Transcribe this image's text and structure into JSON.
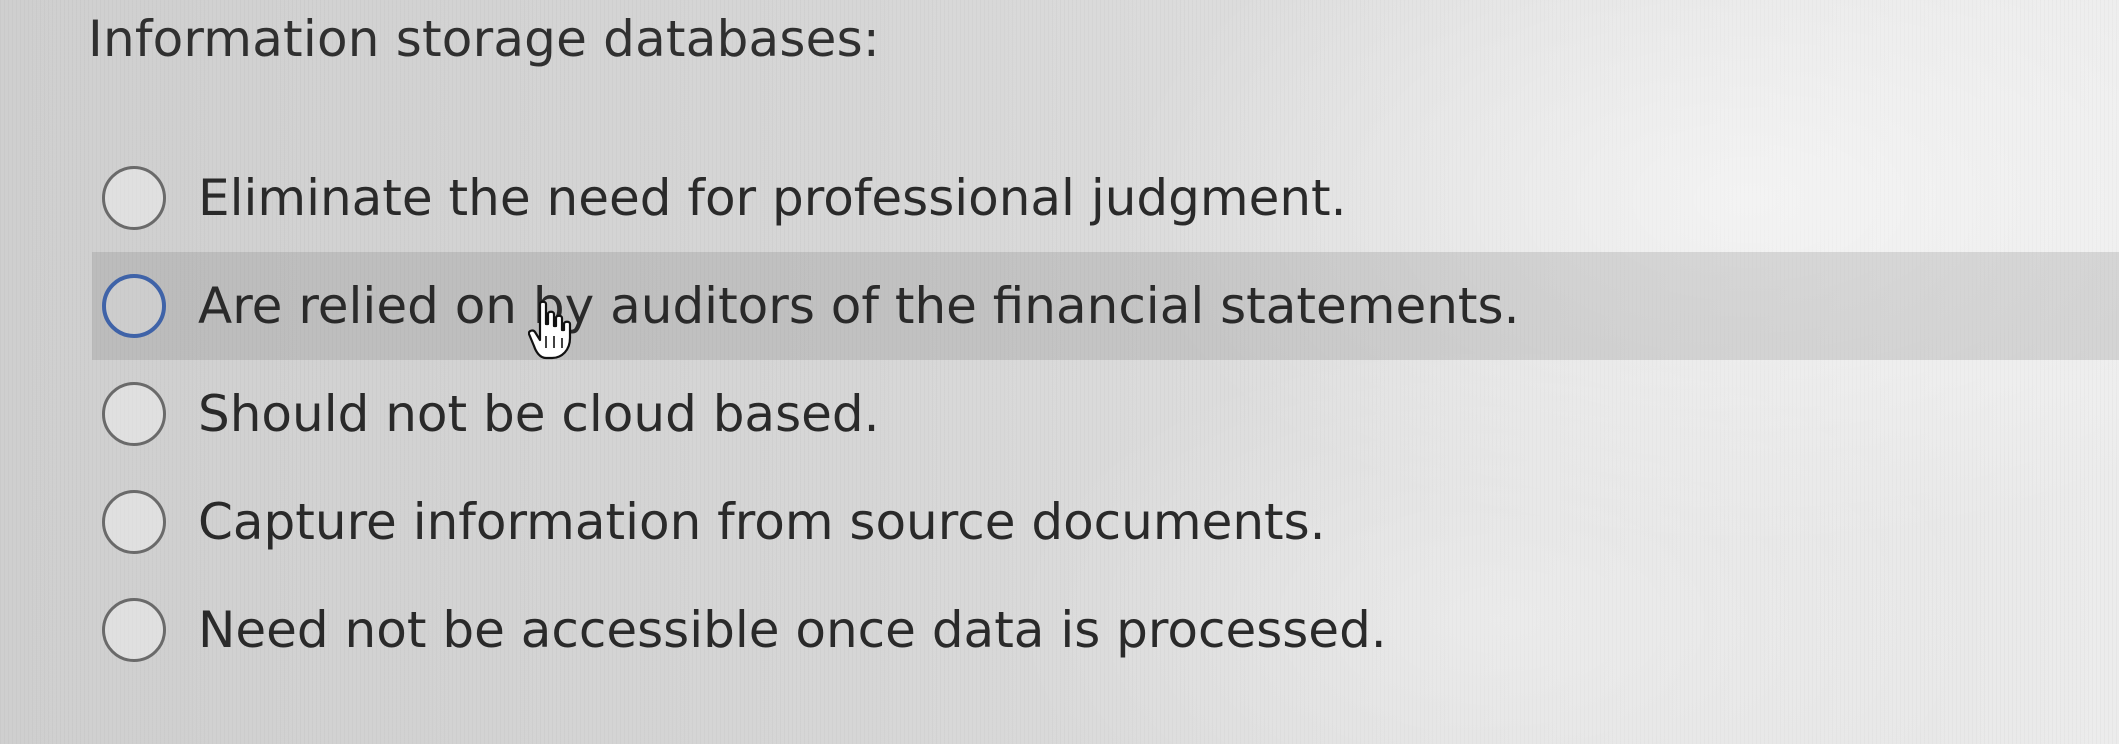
{
  "question": {
    "text": "Information storage databases:"
  },
  "options": [
    {
      "label": "Eliminate the need for professional judgment.",
      "selected": false
    },
    {
      "label": "Are relied on by auditors of the financial statements.",
      "selected": false,
      "hovered": true
    },
    {
      "label": "Should not be cloud based.",
      "selected": false
    },
    {
      "label": "Capture information from source documents.",
      "selected": false
    },
    {
      "label": "Need not be accessible once data is processed.",
      "selected": false
    }
  ],
  "colors": {
    "hover_radio_border": "#3f63a8",
    "radio_border": "#6a6a6a"
  },
  "cursor": {
    "icon": "hand-pointer-icon"
  }
}
